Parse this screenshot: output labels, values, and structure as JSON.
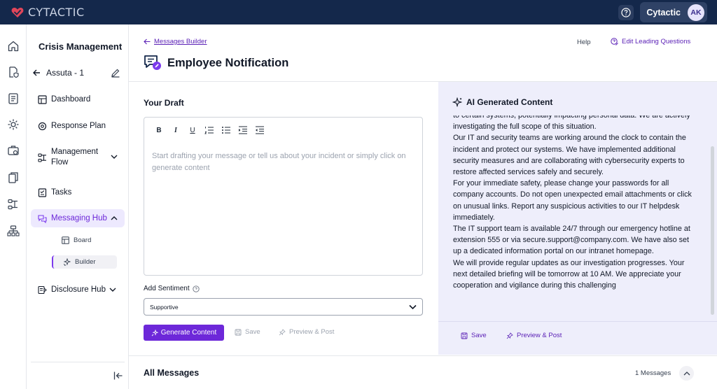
{
  "app": {
    "brand": "CYTACTIC",
    "user_name": "Cytactic",
    "user_initials": "AK"
  },
  "rail": {
    "icons": [
      "home-icon",
      "file-shield-icon",
      "report-icon",
      "incident-icon",
      "toolbox-icon",
      "documents-icon",
      "workflow-icon",
      "org-chart-icon"
    ]
  },
  "sidebar": {
    "heading": "Crisis Management",
    "incident": "Assuta - 1",
    "items": [
      {
        "label": "Dashboard"
      },
      {
        "label": "Response Plan"
      },
      {
        "label": "Management\nFlow"
      },
      {
        "label": "Tasks"
      },
      {
        "label": "Messaging Hub"
      },
      {
        "label": "Disclosure Hub"
      }
    ],
    "subitems": [
      {
        "label": "Board"
      },
      {
        "label": "Builder"
      }
    ]
  },
  "header": {
    "breadcrumb": "Messages Builder",
    "help": "Help",
    "edit_questions": "Edit Leading Questions",
    "title": "Employee Notification"
  },
  "draft": {
    "title": "Your Draft",
    "placeholder": "Start drafting your message or tell us about your incident or simply click on generate content",
    "toolbar": [
      "B",
      "I",
      "U",
      "ordered-list",
      "bullet-list",
      "indent",
      "outdent"
    ]
  },
  "sentiment": {
    "label": "Add Sentiment",
    "value": "Supportive"
  },
  "actions": {
    "generate": "Generate Content",
    "save": "Save",
    "preview": "Preview & Post"
  },
  "ai": {
    "title": "AI Generated Content",
    "paragraphs": [
      "to certain systems, potentially impacting personal data. We are actively investigating the full scope of this situation.",
      "Our IT and security teams are working around the clock to contain the incident and protect our systems. We have implemented additional security measures and are collaborating with cybersecurity experts to restore affected services safely and securely.",
      "For your immediate safety, please change your passwords for all company accounts. Do not open unexpected email attachments or click on unusual links. Report any suspicious activities to our IT helpdesk immediately.",
      "The IT support team is available 24/7 through our emergency hotline at extension 555 or via secure.support@company.com. We have also set up a dedicated information portal on our intranet homepage.",
      "We will provide regular updates as our investigation progresses. Your next detailed briefing will be tomorrow at 10 AM. We appreciate your cooperation and vigilance during this challenging"
    ],
    "save": "Save",
    "preview": "Preview & Post"
  },
  "messages": {
    "title": "All Messages",
    "count": "1 Messages"
  },
  "colors": {
    "brand_red": "#e0465a",
    "topbar": "#14284b",
    "accent": "#6d28d9",
    "ai_panel": "#eeeefb"
  }
}
